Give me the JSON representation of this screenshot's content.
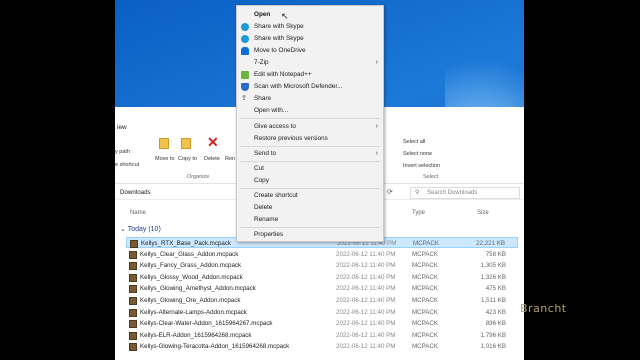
{
  "ribbon": {
    "view_tab": "iew",
    "copy_path": "y path",
    "paste_shortcut": "e shortcut",
    "move_to": "Move to",
    "copy_to": "Copy to",
    "delete": "Delete",
    "rename": "Ren",
    "organize": "Organize",
    "select_all": "Select all",
    "select_none": "Select none",
    "invert_selection": "Invert selection",
    "select_group": "Select"
  },
  "address": {
    "path": "Downloads",
    "search_placeholder": "Search Downloads"
  },
  "columns": {
    "name": "Name",
    "type": "Type",
    "size": "Size"
  },
  "group": {
    "label": "Today (10)"
  },
  "files": [
    {
      "name": "Kellys_RTX_Base_Pack.mcpack",
      "date": "2022-06-12 11:40 PM",
      "type": "MCPACK",
      "size": "22,221 KB"
    },
    {
      "name": "Kellys_Clear_Glass_Addon.mcpack",
      "date": "2022-06-12 11:40 PM",
      "type": "MCPACK",
      "size": "758 KB"
    },
    {
      "name": "Kellys_Fancy_Grass_Addon.mcpack",
      "date": "2022-06-12 11:40 PM",
      "type": "MCPACK",
      "size": "1,305 KB"
    },
    {
      "name": "Kellys_Glossy_Wood_Addon.mcpack",
      "date": "2022-06-12 11:40 PM",
      "type": "MCPACK",
      "size": "1,326 KB"
    },
    {
      "name": "Kellys_Glowing_Amethyst_Addon.mcpack",
      "date": "2022-06-12 11:40 PM",
      "type": "MCPACK",
      "size": "475 KB"
    },
    {
      "name": "Kellys_Glowing_Ore_Addon.mcpack",
      "date": "2022-06-12 11:40 PM",
      "type": "MCPACK",
      "size": "1,511 KB"
    },
    {
      "name": "Kellys-Alternate-Lamps-Addon.mcpack",
      "date": "2022-06-12 11:40 PM",
      "type": "MCPACK",
      "size": "423 KB"
    },
    {
      "name": "Kellys-Clear-Water-Addon_1615964267.mcpack",
      "date": "2022-06-12 11:40 PM",
      "type": "MCPACK",
      "size": "896 KB"
    },
    {
      "name": "Kellys-ELR-Addon_1615964268.mcpack",
      "date": "2022-06-12 11:40 PM",
      "type": "MCPACK",
      "size": "1,796 KB"
    },
    {
      "name": "Kellys-Glowing-Teracotta-Addon_1615964268.mcpack",
      "date": "2022-06-12 11:40 PM",
      "type": "MCPACK",
      "size": "1,016 KB"
    }
  ],
  "context_menu": {
    "open": "Open",
    "share_skype_1": "Share with Skype",
    "share_skype_2": "Share with Skype",
    "move_onedrive": "Move to OneDrive",
    "seven_zip": "7-Zip",
    "notepad": "Edit with Notepad++",
    "defender": "Scan with Microsoft Defender...",
    "share": "Share",
    "open_with": "Open with...",
    "give_access": "Give access to",
    "restore": "Restore previous versions",
    "send_to": "Send to",
    "cut": "Cut",
    "copy": "Copy",
    "create_shortcut": "Create shortcut",
    "delete": "Delete",
    "rename": "Rename",
    "properties": "Properties"
  },
  "watermark": "Brancht",
  "colors": {
    "accent": "#0a5fc4",
    "selection": "#cce8ff",
    "watermark": "#b79f6b"
  }
}
